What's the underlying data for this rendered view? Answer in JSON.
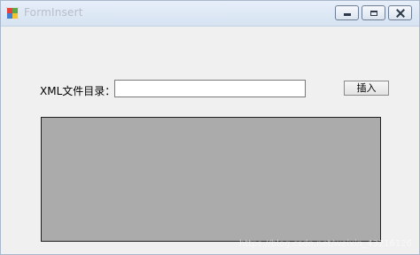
{
  "window": {
    "title": "FormInsert"
  },
  "form": {
    "path_label": "XML文件目录：",
    "path_value": "",
    "insert_button": "插入"
  },
  "watermark": "https://blog.csdn.net/weixin_43216126",
  "colors": {
    "window_bg": "#f0f0f0",
    "panel_bg": "#ababab"
  }
}
